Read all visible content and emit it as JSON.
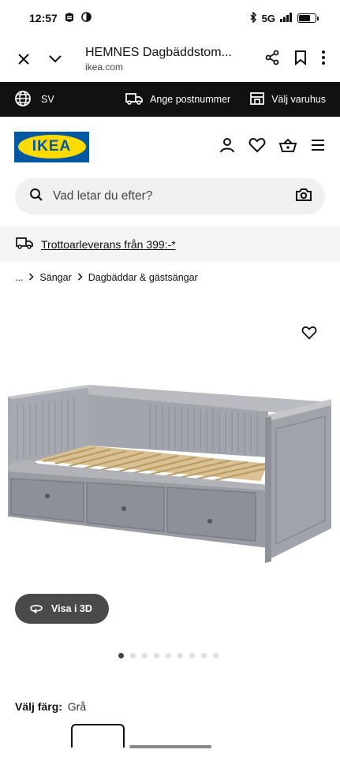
{
  "status_bar": {
    "time": "12:57",
    "network": "5G"
  },
  "browser": {
    "title": "HEMNES Dagbäddstom...",
    "domain": "ikea.com"
  },
  "strip": {
    "language": "SV",
    "postcode_label": "Ange postnummer",
    "store_label": "Välj varuhus"
  },
  "header": {
    "logo_text": "IKEA"
  },
  "search": {
    "placeholder": "Vad letar du efter?"
  },
  "delivery": {
    "text": "Trottoarleverans från 399:-*"
  },
  "breadcrumb": {
    "items": [
      "...",
      "Sängar",
      "Dagbäddar & gästsängar"
    ]
  },
  "product": {
    "view_3d_label": "Visa i 3D",
    "image_count": 9,
    "active_image": 0
  },
  "color": {
    "label": "Välj färg:",
    "value": "Grå"
  },
  "colors": {
    "strip_bg": "#111111",
    "logo_blue": "#0058a3",
    "logo_yellow": "#ffdb00",
    "bed_gray": "#9a9ca3"
  }
}
